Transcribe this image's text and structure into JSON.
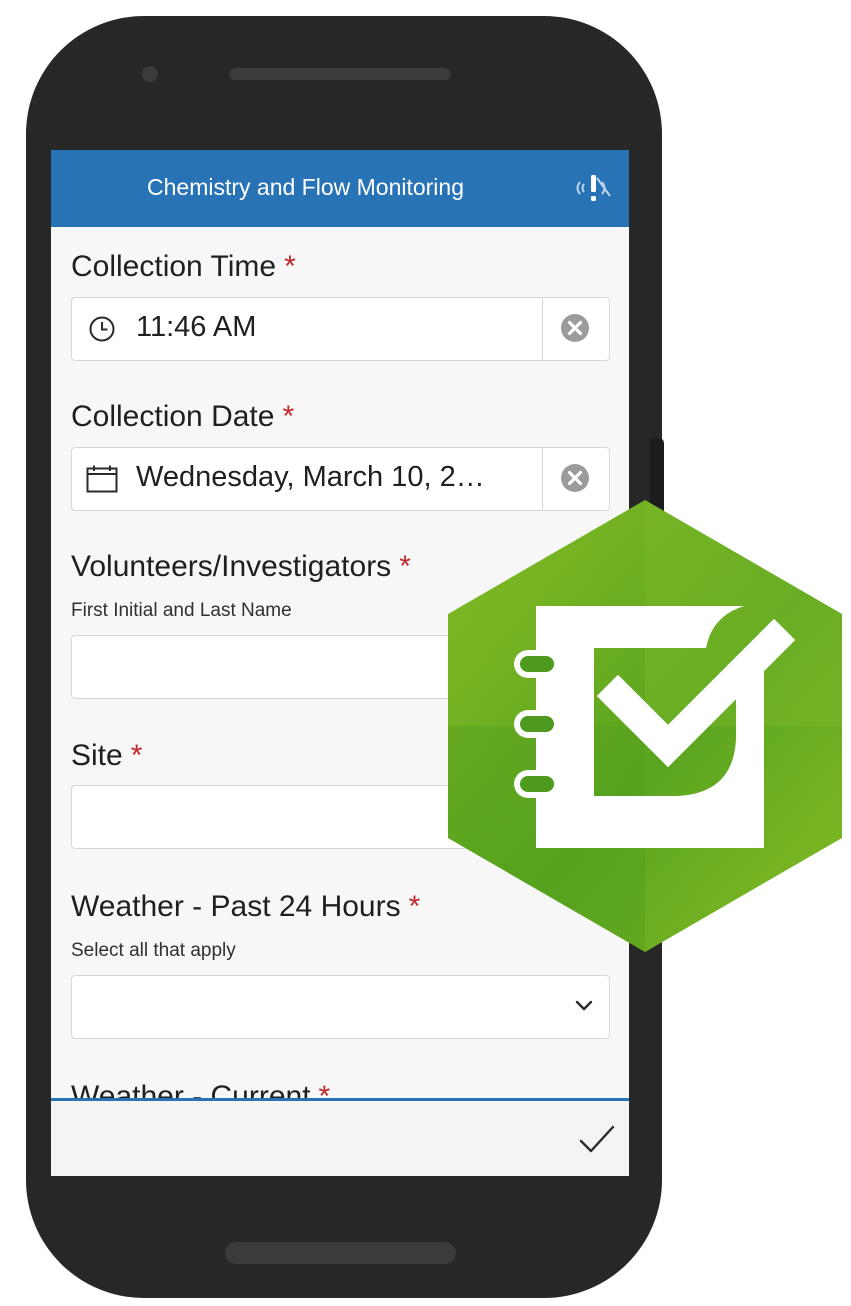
{
  "header": {
    "title": "Chemistry and Flow Monitoring",
    "status_icon": "signal-warning-icon"
  },
  "form": {
    "required_marker": "*",
    "collection_time": {
      "label": "Collection Time",
      "value": "11:46 AM",
      "icon": "clock-icon"
    },
    "collection_date": {
      "label": "Collection Date",
      "value": "Wednesday, March 10, 2…",
      "icon": "calendar-icon"
    },
    "volunteers": {
      "label": "Volunteers/Investigators",
      "hint": "First Initial and Last Name",
      "value": ""
    },
    "site": {
      "label": "Site",
      "value": ""
    },
    "weather_past": {
      "label": "Weather - Past 24 Hours",
      "hint": "Select all that apply",
      "value": ""
    },
    "weather_current": {
      "label": "Weather - Current"
    }
  },
  "footer": {
    "submit_icon": "checkmark-icon"
  },
  "logo": {
    "name": "survey123-logo",
    "colors": {
      "light": "#86bc25",
      "dark": "#4e9a1e",
      "fg": "#ffffff"
    }
  },
  "colors": {
    "accent": "#2872b6",
    "required": "#c0282d"
  }
}
